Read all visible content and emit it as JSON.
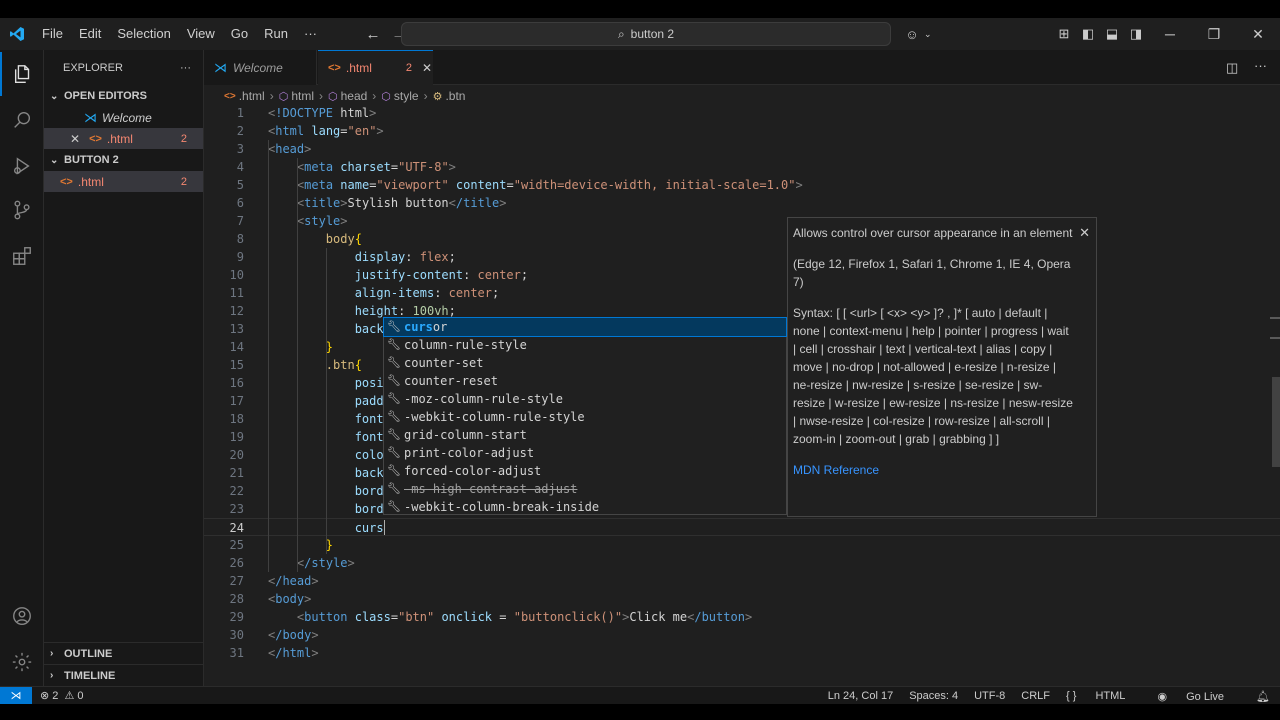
{
  "menu": [
    "File",
    "Edit",
    "Selection",
    "View",
    "Go",
    "Run",
    "···"
  ],
  "command_center": "button 2",
  "explorer": {
    "title": "EXPLORER",
    "more": "···",
    "open_editors_label": "OPEN EDITORS",
    "open_editors": [
      {
        "name": "Welcome",
        "badge": ""
      },
      {
        "name": ".html",
        "badge": "2"
      }
    ],
    "folder_label": "BUTTON 2",
    "folder_files": [
      {
        "name": ".html",
        "badge": "2"
      }
    ],
    "outline_label": "OUTLINE",
    "timeline_label": "TIMELINE"
  },
  "tabs": [
    {
      "label": "Welcome",
      "active": false
    },
    {
      "label": ".html",
      "badge": "2",
      "active": true
    }
  ],
  "breadcrumb": [
    ".html",
    "html",
    "head",
    "style",
    ".btn"
  ],
  "editor": {
    "current_line": 24,
    "lines": [
      {
        "n": "1",
        "code": "<!DOCTYPE html>"
      },
      {
        "n": "2",
        "code": "<html lang=\"en\">"
      },
      {
        "n": "3",
        "code": "<head>"
      },
      {
        "n": "4",
        "code": "    <meta charset=\"UTF-8\">"
      },
      {
        "n": "5",
        "code": "    <meta name=\"viewport\" content=\"width=device-width, initial-scale=1.0\">"
      },
      {
        "n": "6",
        "code": "    <title>Stylish button</title>"
      },
      {
        "n": "7",
        "code": "    <style>"
      },
      {
        "n": "8",
        "code": "        body{"
      },
      {
        "n": "9",
        "code": "            display: flex;"
      },
      {
        "n": "10",
        "code": "            justify-content: center;"
      },
      {
        "n": "11",
        "code": "            align-items: center;"
      },
      {
        "n": "12",
        "code": "            height: 100vh;"
      },
      {
        "n": "13",
        "code": "            back"
      },
      {
        "n": "14",
        "code": "        }"
      },
      {
        "n": "15",
        "code": "        .btn{"
      },
      {
        "n": "16",
        "code": "            posi"
      },
      {
        "n": "17",
        "code": "            padd"
      },
      {
        "n": "18",
        "code": "            font"
      },
      {
        "n": "19",
        "code": "            font"
      },
      {
        "n": "20",
        "code": "            colo"
      },
      {
        "n": "21",
        "code": "            back"
      },
      {
        "n": "22",
        "code": "            bord"
      },
      {
        "n": "23",
        "code": "            bord"
      },
      {
        "n": "24",
        "code": "            curs"
      },
      {
        "n": "25",
        "code": "        }"
      },
      {
        "n": "26",
        "code": "    </style>"
      },
      {
        "n": "27",
        "code": "</head>"
      },
      {
        "n": "28",
        "code": "<body>"
      },
      {
        "n": "29",
        "code": "    <button class=\"btn\" onclick = \"buttonclick()\">Click me</button>"
      },
      {
        "n": "30",
        "code": "</body>"
      },
      {
        "n": "31",
        "code": "</html>"
      }
    ]
  },
  "suggestions": [
    {
      "label": "cursor",
      "match": "curs",
      "selected": true,
      "deprecated": false
    },
    {
      "label": "column-rule-style",
      "selected": false,
      "deprecated": false
    },
    {
      "label": "counter-set",
      "selected": false,
      "deprecated": false
    },
    {
      "label": "counter-reset",
      "selected": false,
      "deprecated": false
    },
    {
      "label": "-moz-column-rule-style",
      "selected": false,
      "deprecated": false
    },
    {
      "label": "-webkit-column-rule-style",
      "selected": false,
      "deprecated": false
    },
    {
      "label": "grid-column-start",
      "selected": false,
      "deprecated": false
    },
    {
      "label": "print-color-adjust",
      "selected": false,
      "deprecated": false
    },
    {
      "label": "forced-color-adjust",
      "selected": false,
      "deprecated": false
    },
    {
      "label": "-ms-high-contrast-adjust",
      "selected": false,
      "deprecated": true
    },
    {
      "label": "-webkit-column-break-inside",
      "selected": false,
      "deprecated": false
    }
  ],
  "doc": {
    "description": "Allows control over cursor appearance in an element",
    "support": "(Edge 12, Firefox 1, Safari 1, Chrome 1, IE 4, Opera 7)",
    "syntax": "Syntax: [ [ <url> [ <x> <y> ]? , ]* [ auto | default | none | context-menu | help | pointer | progress | wait | cell | crosshair | text | vertical-text | alias | copy | move | no-drop | not-allowed | e-resize | n-resize | ne-resize | nw-resize | s-resize | se-resize | sw-resize | w-resize | ew-resize | ns-resize | nesw-resize | nwse-resize | col-resize | row-resize | all-scroll | zoom-in | zoom-out | grab | grabbing ] ]",
    "link": "MDN Reference"
  },
  "status": {
    "errors": "2",
    "warnings": "0",
    "position": "Ln 24, Col 17",
    "spaces": "Spaces: 4",
    "encoding": "UTF-8",
    "eol": "CRLF",
    "language": "HTML",
    "golive": "Go Live"
  },
  "colors": {
    "accent": "#0078d4",
    "error": "#f48771",
    "html_icon": "#e37933"
  },
  "icons": [
    "vscode-logo",
    "files-icon",
    "search-icon",
    "run-debug-icon",
    "source-control-icon",
    "extensions-icon",
    "account-icon",
    "manage-gear-icon",
    "copilot-icon",
    "layout-icon",
    "split-editor-icon",
    "bell-icon"
  ]
}
